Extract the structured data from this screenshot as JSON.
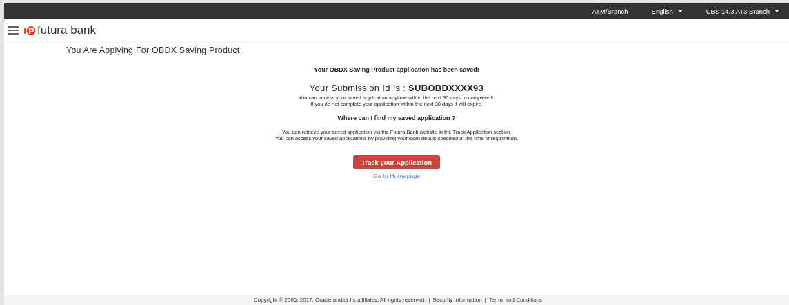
{
  "top_bar": {
    "items": [
      {
        "label": "ATM/Branch",
        "dropdown": false
      },
      {
        "label": "English",
        "dropdown": true
      },
      {
        "label": "UBS 14.3 AT3 Branch",
        "dropdown": true
      }
    ]
  },
  "header": {
    "brand": "futura bank"
  },
  "page_title": "You Are Applying For OBDX Saving Product",
  "confirmation": {
    "saved_message": "Your OBDX Saving Product application has been saved!",
    "submission": "Your Submission Id Is : **SUBOBDXXXX93**",
    "access_lines": [
      "You can access your saved application anytime within the next 30 days to complete it.",
      "If you do not complete your application within the next 30 days it will expire."
    ],
    "question": "Where can I find my saved application ?",
    "retrieve_lines": [
      "You can retrieve your saved application via the Futura Bank website in the Track Application section.",
      "You can access your saved applications by providing your login details specified at the time of registration."
    ],
    "primary_button": "Track your Application",
    "link": "Go to Homepage"
  },
  "footer": {
    "copyright": "Copyright © 2006, 2017, Oracle and/or its affiliates. All rights reserved.",
    "links": [
      {
        "separator": "|",
        "label": "Security Information"
      },
      {
        "separator": "|",
        "label": "Terms and Conditions"
      }
    ]
  }
}
